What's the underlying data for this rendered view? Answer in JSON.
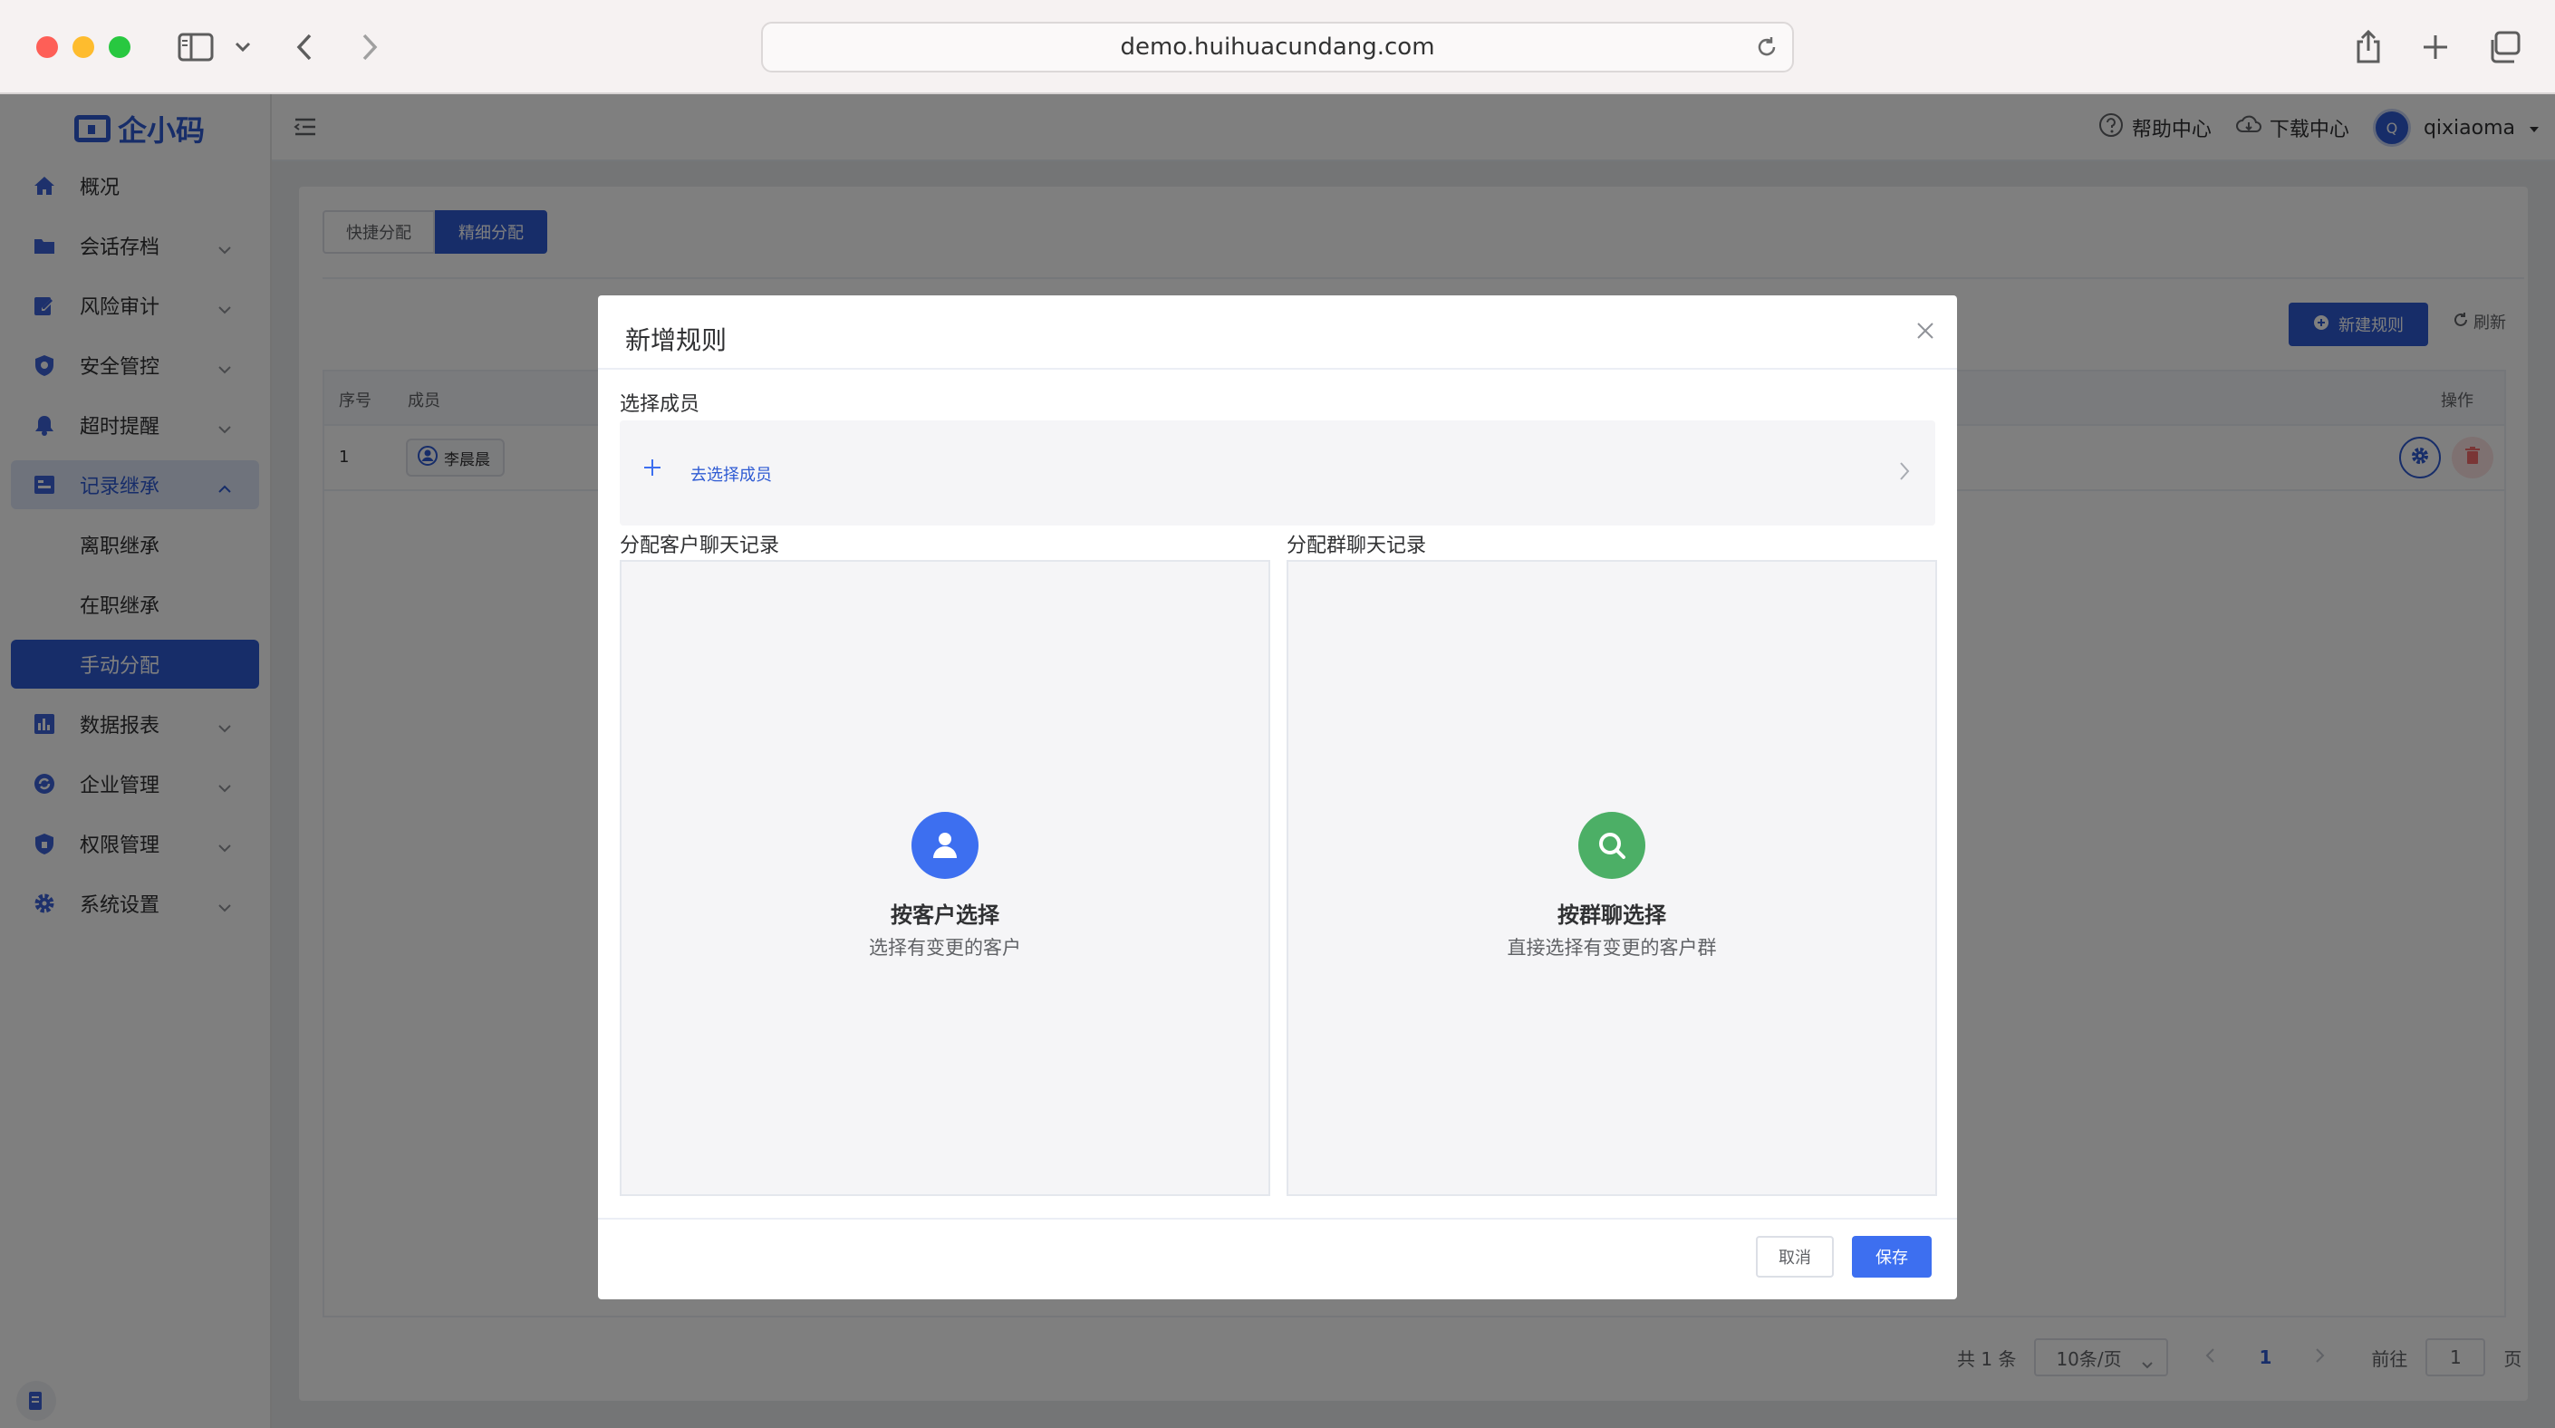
{
  "browser": {
    "url": "demo.huihuacundang.com"
  },
  "app": {
    "logo_text": "企小码"
  },
  "sidebar": {
    "items": [
      {
        "label": "概况",
        "icon": "home-icon"
      },
      {
        "label": "会话存档",
        "icon": "folder-icon"
      },
      {
        "label": "风险审计",
        "icon": "edit-icon"
      },
      {
        "label": "安全管控",
        "icon": "shield-icon"
      },
      {
        "label": "超时提醒",
        "icon": "bell-icon"
      },
      {
        "label": "记录继承",
        "icon": "record-icon"
      },
      {
        "label": "数据报表",
        "icon": "chart-icon"
      },
      {
        "label": "企业管理",
        "icon": "enterprise-icon"
      },
      {
        "label": "权限管理",
        "icon": "lock-shield-icon"
      },
      {
        "label": "系统设置",
        "icon": "gear-icon"
      }
    ],
    "sub_items": [
      {
        "label": "离职继承"
      },
      {
        "label": "在职继承"
      },
      {
        "label": "手动分配"
      }
    ]
  },
  "topbar": {
    "help_label": "帮助中心",
    "download_label": "下载中心",
    "avatar_letter": "Q",
    "username": "qixiaoma"
  },
  "page": {
    "tabs": [
      {
        "label": "快捷分配"
      },
      {
        "label": "精细分配"
      }
    ],
    "new_rule_label": "新建规则",
    "refresh_label": "刷新",
    "table": {
      "headers": {
        "index": "序号",
        "member": "成员",
        "actions": "操作"
      },
      "rows": [
        {
          "index": "1",
          "member": "李晨晨"
        }
      ]
    },
    "pagination": {
      "total": "共 1 条",
      "page_size": "10条/页",
      "current_page": "1",
      "goto_label": "前往",
      "goto_value": "1",
      "page_unit": "页"
    }
  },
  "modal": {
    "title": "新增规则",
    "select_member_label": "选择成员",
    "picker_text": "去选择成员",
    "customer_section_label": "分配客户聊天记录",
    "group_section_label": "分配群聊天记录",
    "customer_card": {
      "title": "按客户选择",
      "desc": "选择有变更的客户"
    },
    "group_card": {
      "title": "按群聊选择",
      "desc": "直接选择有变更的客户群"
    },
    "cancel_label": "取消",
    "save_label": "保存"
  },
  "colors": {
    "primary": "#2f5bd3",
    "save_button": "#3d6ff0",
    "customer_icon": "#3d6ff0",
    "group_icon": "#4caf66",
    "danger": "#f56c6c"
  }
}
